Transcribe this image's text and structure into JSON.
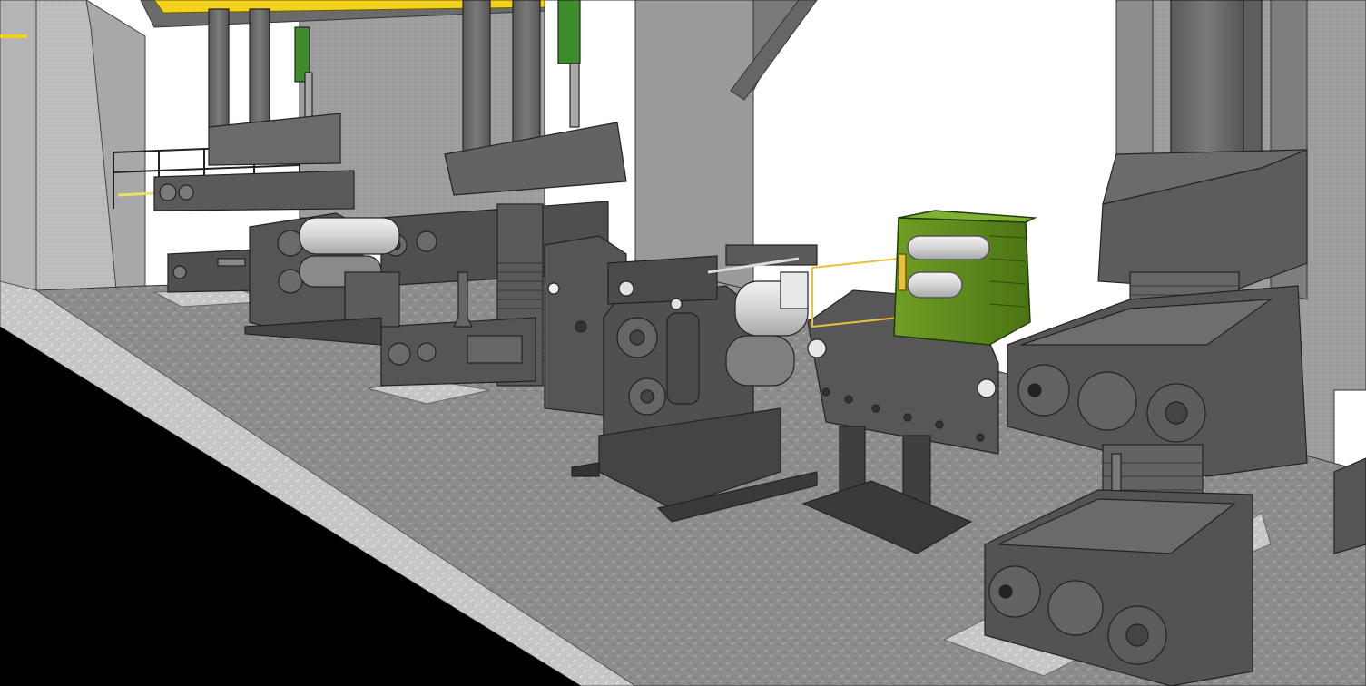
{
  "scene": {
    "subject": "rolling-mill-stands",
    "colors": {
      "sky": "#ffffff",
      "void": "#000000",
      "floor": "#8f8f8f",
      "floor_edge": "#c9c9c9",
      "steel_dark": "#4a4a4a",
      "steel_mid": "#6a6a6a",
      "steel_light": "#8a8a8a",
      "concrete": "#9c9c9c",
      "concrete_light": "#b8b8b8",
      "roll": "#d9d9d9",
      "gearbox": "#5e8a1f",
      "railing": "#e8e06a",
      "accent_yellow": "#f2d21c"
    }
  }
}
